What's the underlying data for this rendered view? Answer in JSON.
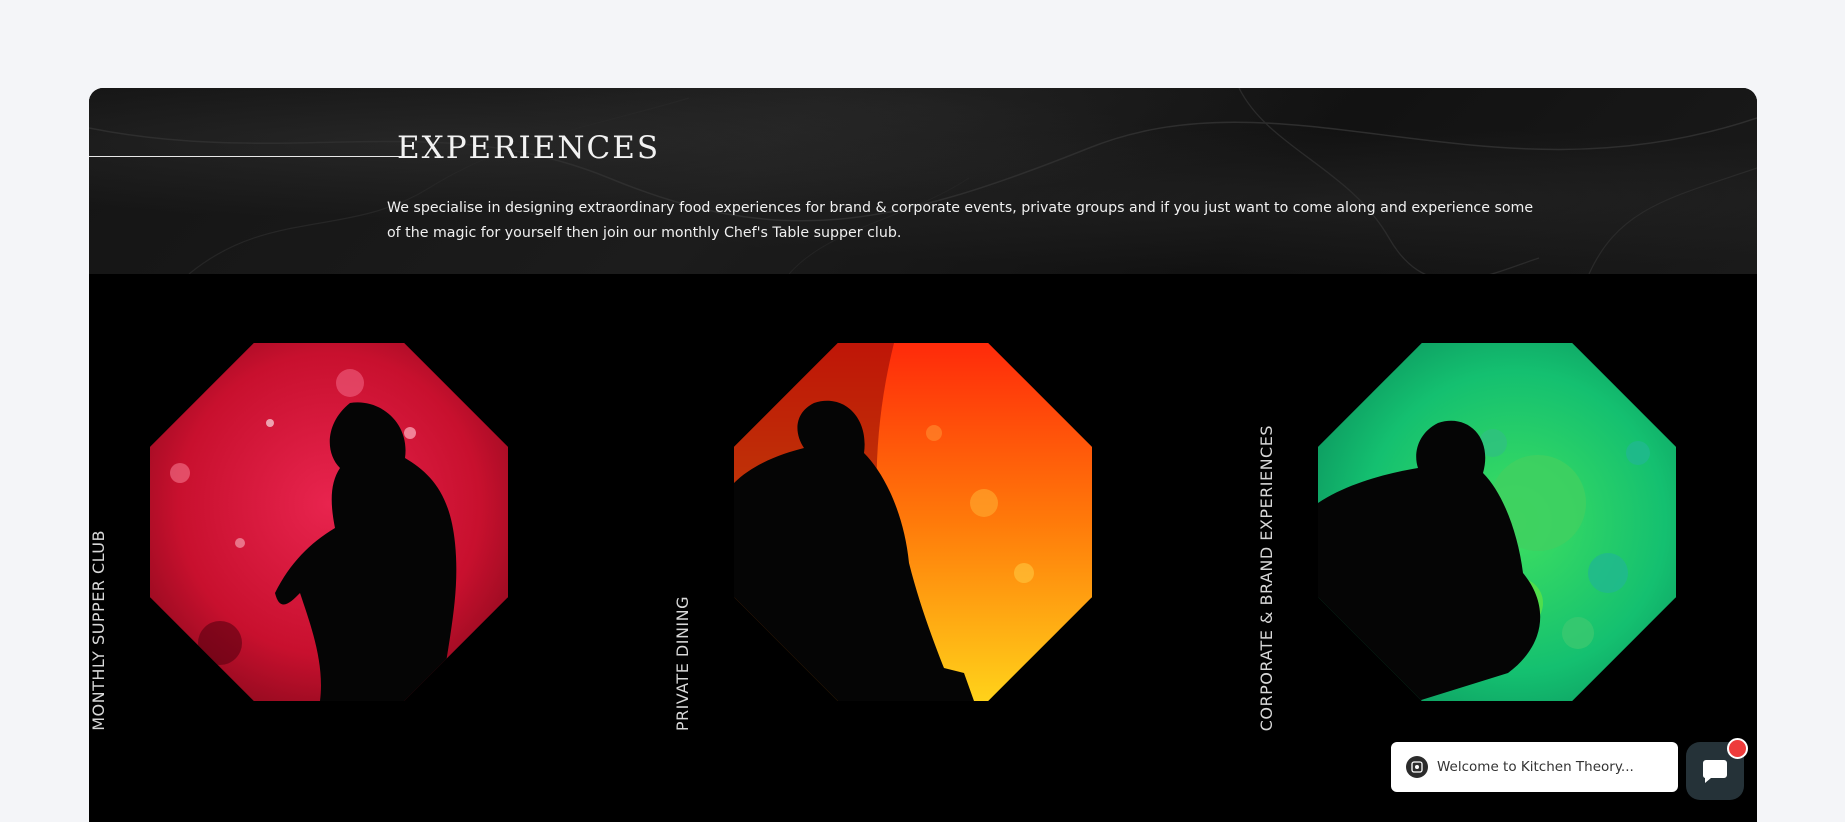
{
  "section": {
    "title": "EXPERIENCES",
    "intro": "We specialise in designing extraordinary food experiences for brand & corporate events, private groups and if you just want to come along and experience some of the magic for yourself then join our monthly Chef's Table supper club."
  },
  "cards": [
    {
      "label": "MONTHLY SUPPER CLUB",
      "theme": "red",
      "colors": [
        "#c8102e",
        "#e8244e",
        "#8a0a1e"
      ]
    },
    {
      "label": "PRIVATE DINING",
      "theme": "orange",
      "colors": [
        "#ff3b0a",
        "#ff7a0a",
        "#ffc21a"
      ]
    },
    {
      "label": "CORPORATE & BRAND EXPERIENCES",
      "theme": "green",
      "colors": [
        "#0fae6e",
        "#22d35a",
        "#0a8a5a"
      ]
    }
  ],
  "chat": {
    "welcome": "Welcome to Kitchen Theory...",
    "avatar_icon": "chat-avatar-icon",
    "button_icon": "chat-icon",
    "notification_color": "#ee3b3b"
  }
}
